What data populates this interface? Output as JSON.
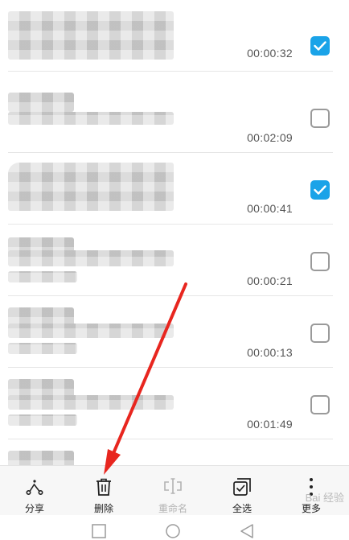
{
  "recordings": [
    {
      "duration": "00:00:32",
      "checked": true
    },
    {
      "duration": "00:02:09",
      "checked": false
    },
    {
      "duration": "00:00:41",
      "checked": true
    },
    {
      "duration": "00:00:21",
      "checked": false
    },
    {
      "duration": "00:00:13",
      "checked": false
    },
    {
      "duration": "00:01:49",
      "checked": false
    }
  ],
  "toolbar": {
    "share_label": "分享",
    "delete_label": "删除",
    "rename_label": "重命名",
    "select_all_label": "全选",
    "more_label": "更多"
  },
  "watermark": "Bai 经验",
  "colors": {
    "checkbox_checked": "#1aa3e8",
    "arrow": "#e8261f",
    "disabled_text": "#b3b3b3"
  },
  "icons": {
    "share": "share-icon",
    "delete": "trash-icon",
    "rename": "rename-icon",
    "select_all": "select-all-icon",
    "more": "more-vertical-icon",
    "nav_recent": "square-icon",
    "nav_home": "circle-icon",
    "nav_back": "triangle-back-icon"
  }
}
